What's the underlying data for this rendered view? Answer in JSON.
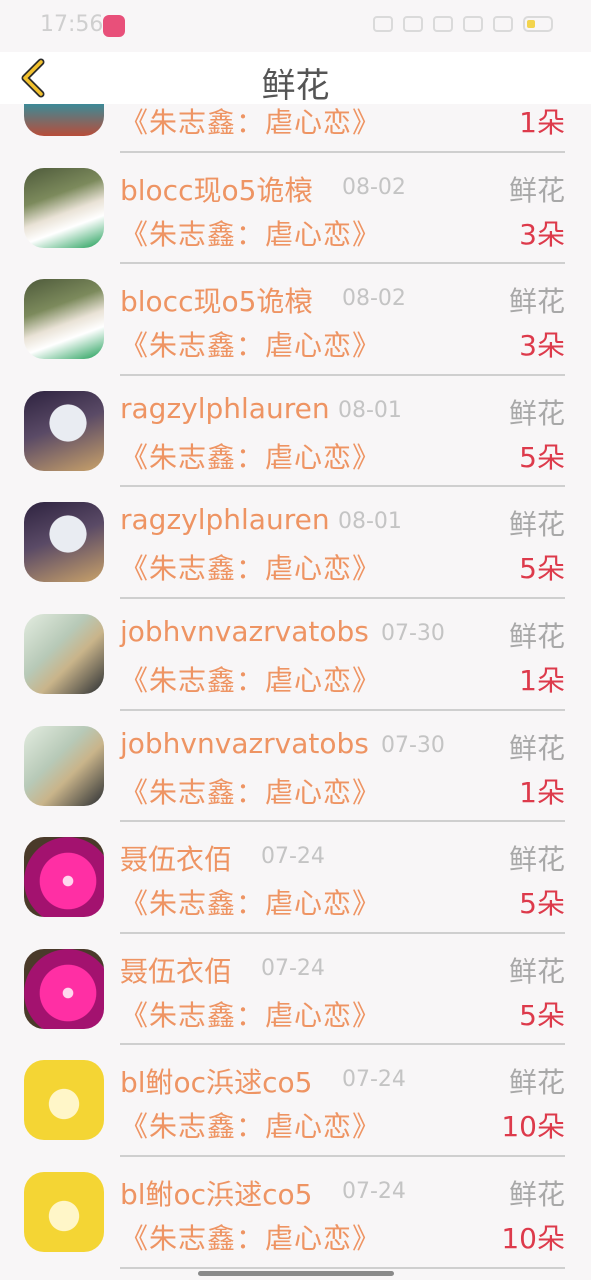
{
  "status_bar": {
    "time": "17:56"
  },
  "header": {
    "title": "鲜花"
  },
  "colors": {
    "username": "#ee9463",
    "quantity": "#dd3a4b",
    "muted": "#a8a8a8"
  },
  "rows": [
    {
      "username": "",
      "date": "",
      "gift": "",
      "album": "《朱志鑫：虐心恋》",
      "quantity": "1朵"
    },
    {
      "username": "blocc现o5诡榱",
      "date": "08-02",
      "gift": "鲜花",
      "album": "《朱志鑫：虐心恋》",
      "quantity": "3朵"
    },
    {
      "username": "blocc现o5诡榱",
      "date": "08-02",
      "gift": "鲜花",
      "album": "《朱志鑫：虐心恋》",
      "quantity": "3朵"
    },
    {
      "username": "ragzylphlauren",
      "date": "08-01",
      "gift": "鲜花",
      "album": "《朱志鑫：虐心恋》",
      "quantity": "5朵"
    },
    {
      "username": "ragzylphlauren",
      "date": "08-01",
      "gift": "鲜花",
      "album": "《朱志鑫：虐心恋》",
      "quantity": "5朵"
    },
    {
      "username": "jobhvnvazrvatobs",
      "date": "07-30",
      "gift": "鲜花",
      "album": "《朱志鑫：虐心恋》",
      "quantity": "1朵"
    },
    {
      "username": "jobhvnvazrvatobs",
      "date": "07-30",
      "gift": "鲜花",
      "album": "《朱志鑫：虐心恋》",
      "quantity": "1朵"
    },
    {
      "username": "聂伍衣佰",
      "date": "07-24",
      "gift": "鲜花",
      "album": "《朱志鑫：虐心恋》",
      "quantity": "5朵"
    },
    {
      "username": "聂伍衣佰",
      "date": "07-24",
      "gift": "鲜花",
      "album": "《朱志鑫：虐心恋》",
      "quantity": "5朵"
    },
    {
      "username": "bl鲋oc浜逑co5",
      "date": "07-24",
      "gift": "鲜花",
      "album": "《朱志鑫：虐心恋》",
      "quantity": "10朵"
    },
    {
      "username": "bl鲋oc浜逑co5",
      "date": "07-24",
      "gift": "鲜花",
      "album": "《朱志鑫：虐心恋》",
      "quantity": "10朵"
    }
  ]
}
